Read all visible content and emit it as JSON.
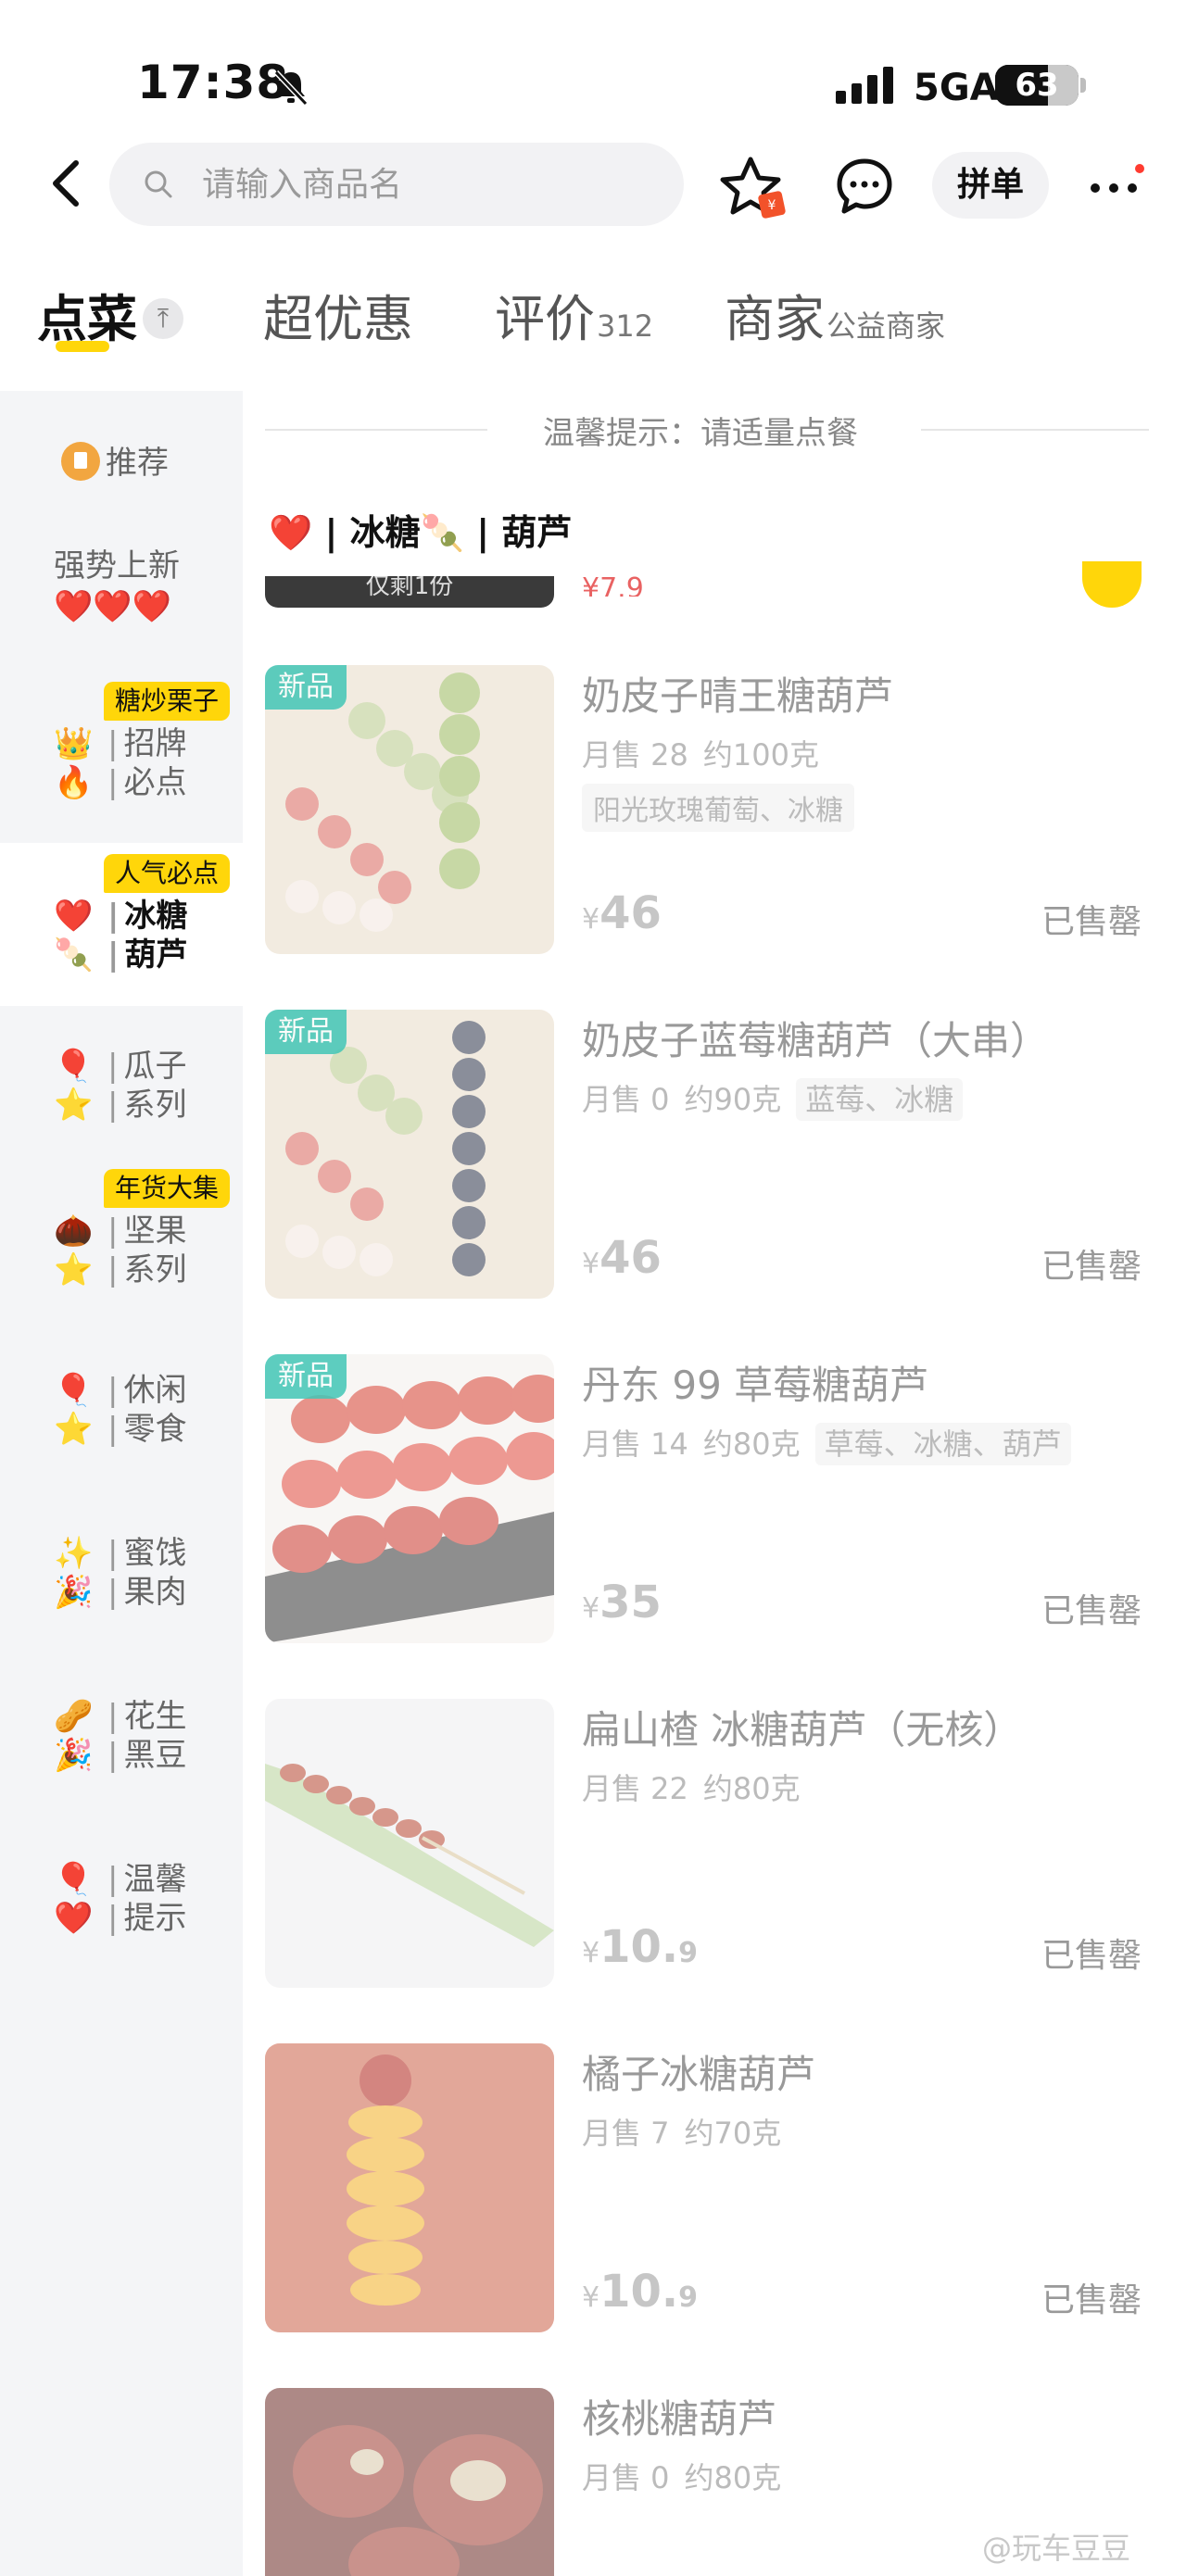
{
  "status_bar": {
    "time": "17:38",
    "network": "5GA",
    "battery": "63",
    "battery_level_percent": 63
  },
  "search": {
    "placeholder": "请输入商品名",
    "group_button": "拼单"
  },
  "tabs": [
    {
      "label": "点菜",
      "sub": ""
    },
    {
      "label": "超优惠",
      "sub": ""
    },
    {
      "label": "评价",
      "sub": "312"
    },
    {
      "label": "商家",
      "sub": "公益商家"
    }
  ],
  "sidebar": {
    "recommend": "推荐",
    "new_arrivals": "强势上新",
    "new_arrivals_emoji": "❤️❤️❤️",
    "chestnut": {
      "badge": "糖炒栗子",
      "line1": "招牌",
      "line2": "必点",
      "emoji1": "👑",
      "emoji2": "🔥"
    },
    "tanghulu": {
      "badge": "人气必点",
      "line1": "冰糖",
      "line2": "葫芦",
      "emoji1": "❤️",
      "emoji2": "🍡"
    },
    "melon": {
      "line1": "瓜子",
      "line2": "系列",
      "emoji1": "🎈",
      "emoji2": "⭐"
    },
    "nuts": {
      "badge": "年货大集",
      "line1": "坚果",
      "line2": "系列",
      "emoji1": "🌰",
      "emoji2": "⭐"
    },
    "snacks": {
      "line1": "休闲",
      "line2": "零食",
      "emoji1": "🎈",
      "emoji2": "⭐"
    },
    "preserved": {
      "line1": "蜜饯",
      "line2": "果肉",
      "emoji1": "✨",
      "emoji2": "🎉"
    },
    "peanuts": {
      "line1": "花生",
      "line2": "黑豆",
      "emoji1": "🥜",
      "emoji2": "🎉"
    },
    "tips": {
      "line1": "温馨",
      "line2": "提示",
      "emoji1": "🎈",
      "emoji2": "❤️"
    }
  },
  "content": {
    "tip": "温馨提示：请适量点餐",
    "section_title": "❤️ | 冰糖🍡 | 葫芦",
    "partial_strip": "仅剩1份",
    "partial_price": "¥7.9"
  },
  "products": [
    {
      "name": "奶皮子晴王糖葫芦",
      "new": "新品",
      "sales": "月售 28",
      "weight": "约100克",
      "ingredients": "阳光玫瑰葡萄、冰糖",
      "price_symbol": "¥",
      "price_int": "46",
      "price_dec": "",
      "status": "已售罄"
    },
    {
      "name": "奶皮子蓝莓糖葫芦（大串）",
      "new": "新品",
      "sales": "月售 0",
      "weight": "约90克",
      "ingredients": "蓝莓、冰糖",
      "price_symbol": "¥",
      "price_int": "46",
      "price_dec": "",
      "status": "已售罄"
    },
    {
      "name": "丹东 99 草莓糖葫芦",
      "new": "新品",
      "sales": "月售 14",
      "weight": "约80克",
      "ingredients": "草莓、冰糖、葫芦",
      "price_symbol": "¥",
      "price_int": "35",
      "price_dec": "",
      "status": "已售罄"
    },
    {
      "name": "扁山楂 冰糖葫芦（无核）",
      "new": "",
      "sales": "月售 22",
      "weight": "约80克",
      "ingredients": "",
      "price_symbol": "¥",
      "price_int": "10.",
      "price_dec": "9",
      "status": "已售罄"
    },
    {
      "name": "橘子冰糖葫芦",
      "new": "",
      "sales": "月售 7",
      "weight": "约70克",
      "ingredients": "",
      "price_symbol": "¥",
      "price_int": "10.",
      "price_dec": "9",
      "status": "已售罄"
    },
    {
      "name": "核桃糖葫芦",
      "new": "",
      "sales": "月售 0",
      "weight": "约80克",
      "ingredients": "",
      "price_symbol": "",
      "price_int": "",
      "price_dec": "",
      "status": ""
    }
  ],
  "watermark": "@玩车豆豆",
  "colors": {
    "accent": "#ffd60a",
    "new_tag": "#43c6b6",
    "sidebar_bg": "#f4f5f7",
    "price_red": "#e02020"
  }
}
